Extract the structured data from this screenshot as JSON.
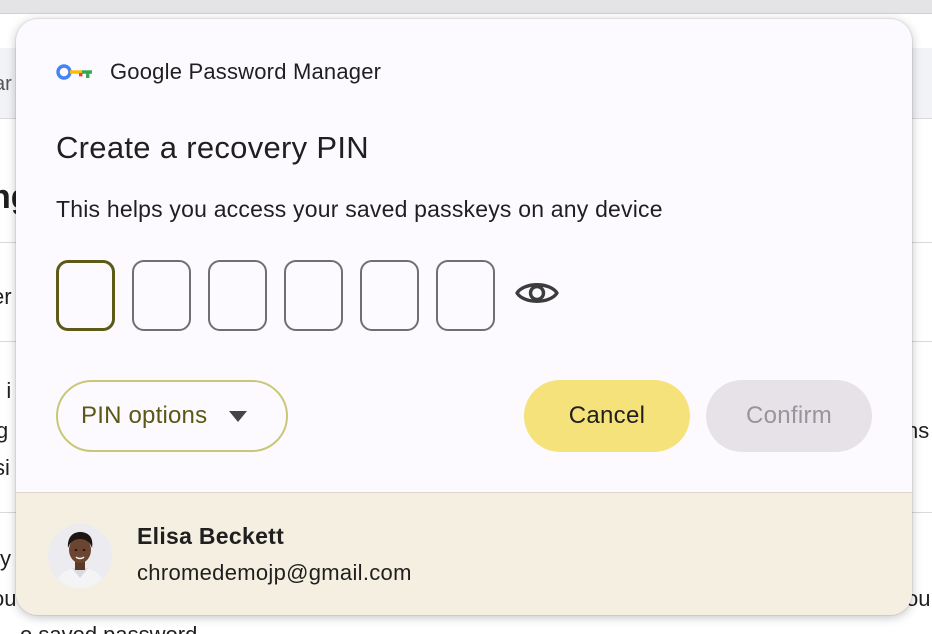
{
  "background_page": {
    "left_fragments": [
      "ar",
      "ng",
      "er",
      "n i",
      "g",
      "si",
      "y",
      "ou"
    ],
    "right_fragments": [
      "ns",
      "ou"
    ],
    "bottom_fragment": "o saved password"
  },
  "dialog": {
    "brand": {
      "icon": "google-password-manager-key-icon",
      "name": "Google Password Manager"
    },
    "title": "Create a recovery PIN",
    "subtitle": "This helps you access your saved passkeys on any device",
    "pin": {
      "length": 6,
      "values": [
        "",
        "",
        "",
        "",
        "",
        ""
      ],
      "active_index": 0,
      "toggle_icon": "eye-icon"
    },
    "buttons": {
      "options": "PIN options",
      "cancel": "Cancel",
      "confirm": "Confirm"
    },
    "account": {
      "name": "Elisa Beckett",
      "email": "chromedemojp@gmail.com"
    }
  },
  "colors": {
    "dialog_bg": "#fdfaff",
    "accent_outline": "#c9c778",
    "accent_text": "#5a5814",
    "cancel_bg": "#f5e27b",
    "confirm_disabled_bg": "#e6e2e8",
    "footer_bg": "#f5efe1"
  }
}
